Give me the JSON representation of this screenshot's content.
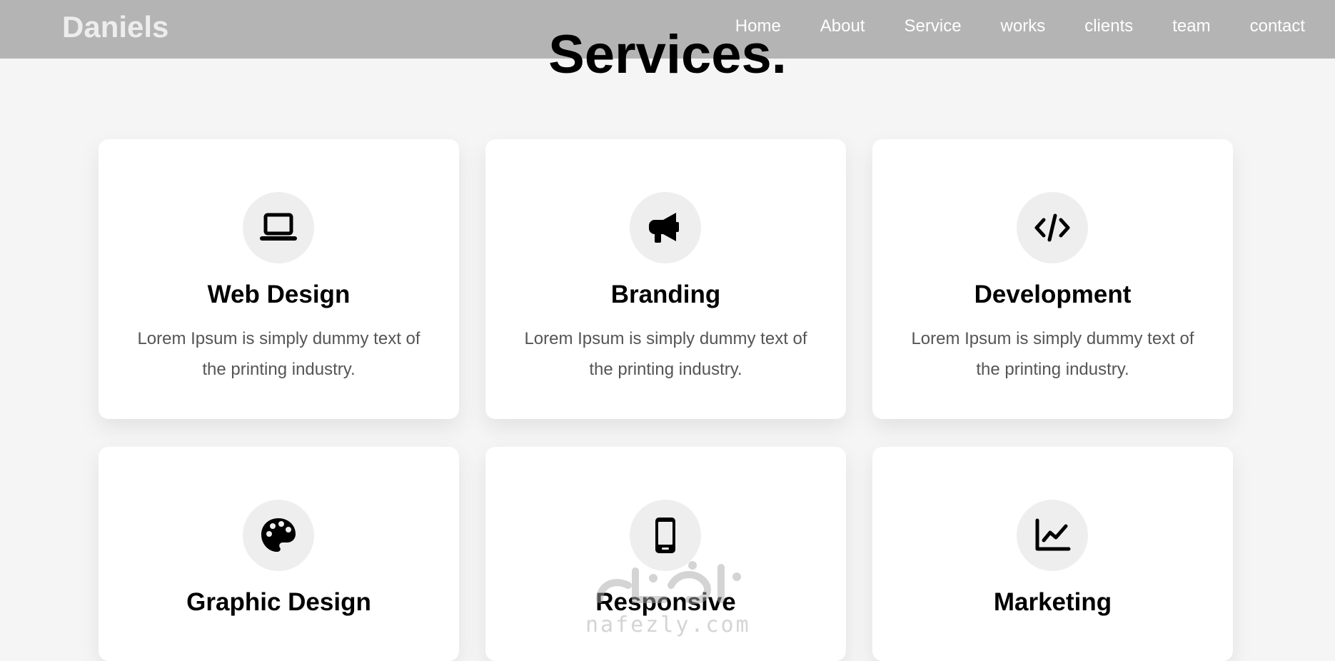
{
  "navbar": {
    "logo": "Daniels",
    "links": [
      "Home",
      "About",
      "Service",
      "works",
      "clients",
      "team",
      "contact"
    ]
  },
  "section": {
    "title": "Services."
  },
  "cards": [
    {
      "icon": "laptop-icon",
      "title": "Web Design",
      "text": "Lorem Ipsum is simply dummy text of the printing industry."
    },
    {
      "icon": "megaphone-icon",
      "title": "Branding",
      "text": "Lorem Ipsum is simply dummy text of the printing industry."
    },
    {
      "icon": "code-icon",
      "title": "Development",
      "text": "Lorem Ipsum is simply dummy text of the printing industry."
    },
    {
      "icon": "palette-icon",
      "title": "Graphic Design"
    },
    {
      "icon": "mobile-phone-icon",
      "title": "Responsive"
    },
    {
      "icon": "chart-line-icon",
      "title": "Marketing"
    }
  ],
  "watermark": {
    "text": "nafezly.com"
  },
  "colors": {
    "navbar_bg": "#b4b4b4",
    "page_bg": "#f5f5f5",
    "card_bg": "#ffffff",
    "icon_circle_bg": "#eeeeee"
  }
}
